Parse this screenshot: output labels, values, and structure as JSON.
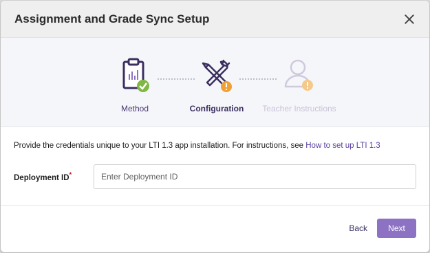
{
  "dialog": {
    "title": "Assignment and Grade Sync Setup"
  },
  "stepper": {
    "steps": [
      {
        "label": "Method",
        "state": "complete",
        "icon": "clipboard-icon"
      },
      {
        "label": "Configuration",
        "state": "current",
        "icon": "tools-icon"
      },
      {
        "label": "Teacher Instructions",
        "state": "upcoming",
        "icon": "user-icon"
      }
    ]
  },
  "body": {
    "instructions_text": "Provide the credentials unique to your LTI 1.3 app installation. For instructions, see ",
    "instructions_link": "How to set up LTI 1.3",
    "deployment_label": "Deployment ID",
    "required_marker": "*",
    "deployment_placeholder": "Enter Deployment ID",
    "deployment_value": ""
  },
  "footer": {
    "back_label": "Back",
    "next_label": "Next"
  },
  "colors": {
    "accent": "#8d72c4",
    "link": "#5b3fa0",
    "success": "#7fb843",
    "warning": "#f0a035",
    "required": "#d0021b"
  }
}
